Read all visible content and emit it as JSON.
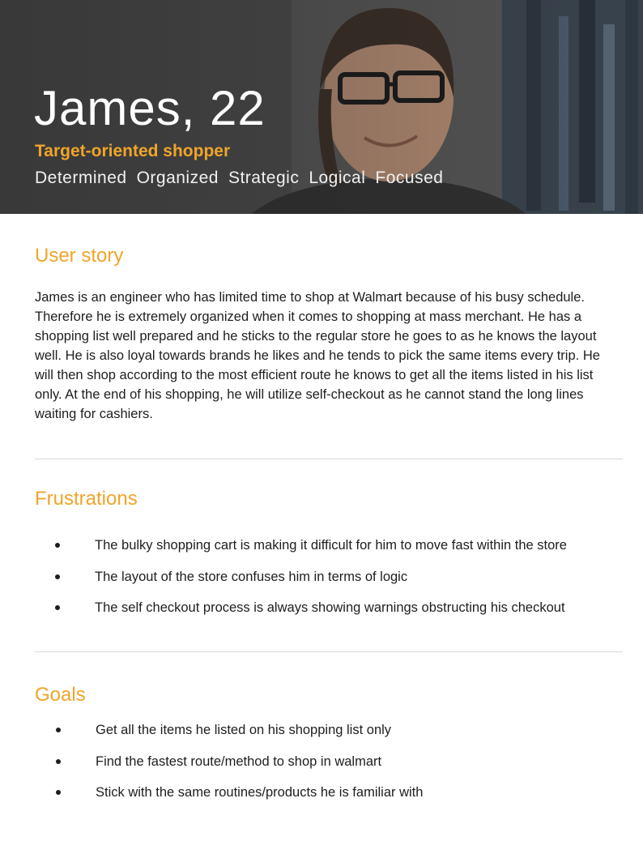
{
  "persona": {
    "name_age": "James, 22",
    "role": "Target-oriented shopper",
    "traits": [
      "Determined",
      "Organized",
      "Strategic",
      "Logical",
      "Focused"
    ]
  },
  "user_story": {
    "heading": "User story",
    "body": "James is an engineer who has limited time to shop at Walmart because of his busy schedule. Therefore he is extremely organized when it comes to shopping at mass merchant. He has a shopping list well prepared and he sticks to the regular store he goes to as he knows the layout well. He is also loyal towards brands he likes and he tends to pick the same items every trip. He will then shop according to the most efficient route he knows to get all the items listed in his list only. At the end of his shopping, he will utilize self-checkout as he cannot stand the long lines waiting for cashiers."
  },
  "frustrations": {
    "heading": "Frustrations",
    "items": [
      "The bulky shopping cart is making it difficult for him to move fast within the store",
      "The layout of the store confuses him in terms of logic",
      "The self checkout process is always showing warnings obstructing his checkout"
    ]
  },
  "goals": {
    "heading": "Goals",
    "items": [
      "Get all the items he listed on his shopping list only",
      "Find the fastest route/method to shop in walmart",
      "Stick with the same routines/products he is familiar with"
    ]
  },
  "colors": {
    "accent": "#f0a52a",
    "text": "#1e1e1e",
    "divider": "#d9d9d9"
  }
}
